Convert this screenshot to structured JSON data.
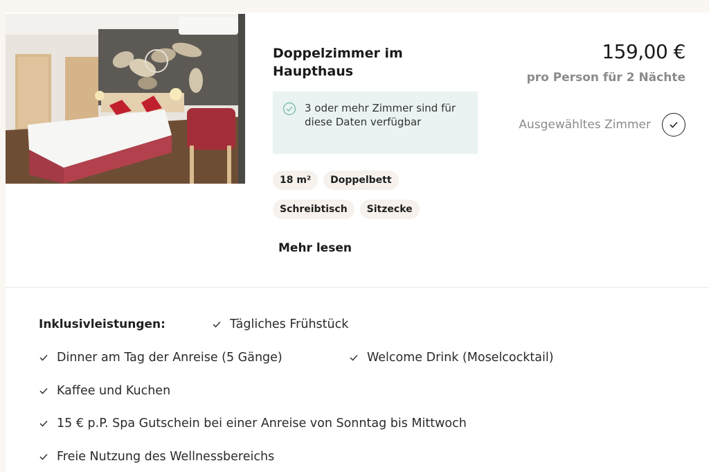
{
  "room": {
    "title": "Doppelzimmer im Haupthaus",
    "price": "159,00 €",
    "price_note": "pro Person für 2 Nächte",
    "selected_label": "Ausgewähltes Zimmer",
    "availability": "3 oder mehr Zimmer sind für diese Daten verfügbar",
    "features": [
      "18 m²",
      "Doppelbett",
      "Schreibtisch",
      "Sitzecke"
    ],
    "more_label": "Mehr lesen"
  },
  "inclusions": {
    "heading": "Inklusivleistungen:",
    "items": [
      "Tägliches Frühstück",
      "Dinner am Tag der Anreise (5 Gänge)",
      "Welcome Drink (Moselcocktail)",
      "Kaffee und Kuchen",
      "15 € p.P. Spa Gutschein bei einer Anreise von Sonntag bis Mittwoch",
      "Freie Nutzung des Wellnessbereichs"
    ]
  },
  "colors": {
    "availability_bg": "#eaf3f2",
    "availability_icon": "#7fbfae",
    "chip_bg": "#f6f1ec",
    "muted_text": "#8b8b8b"
  },
  "icons": {
    "availability": "check-circle-icon",
    "select": "check-circle-outline-icon",
    "inclusion": "check-icon"
  }
}
